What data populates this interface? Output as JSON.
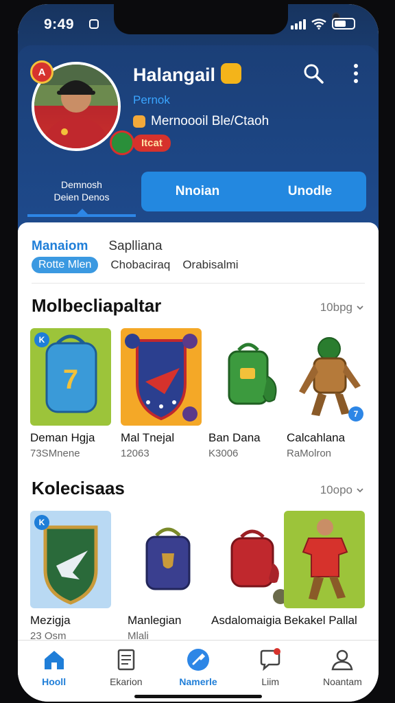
{
  "status_bar": {
    "time": "9:49"
  },
  "profile": {
    "name": "Halangail",
    "sublink": "Pernok",
    "user_line": "Mernoooil Ble/Ctaoh",
    "red_pill": "Itcat"
  },
  "tabs_top": {
    "left_label_line1": "Demnosh",
    "left_label_line2": "Deien Denos",
    "segment": [
      "Nnoian",
      "Unodle"
    ]
  },
  "filters": {
    "row1": [
      "Manaiom",
      "Saplliana"
    ],
    "row2_chip": "Rotte Mlen",
    "row2_items": [
      "Chobaciraq",
      "Orabisalmi"
    ]
  },
  "sections": [
    {
      "title": "Molbecliapaltar",
      "more": "10bpg",
      "items": [
        {
          "title": "Deman Hgja",
          "sub": "73SMnene",
          "bg": "#9cc43a",
          "corner": "K"
        },
        {
          "title": "Mal Tnejal",
          "sub": "12063",
          "bg": "#f4a827",
          "corner": ""
        },
        {
          "title": "Ban Dana",
          "sub": "K3006",
          "bg": "#ffffff",
          "corner": ""
        },
        {
          "title": "Calcahlana",
          "sub": "RaMolron",
          "bg": "#ffffff",
          "corner": "7"
        }
      ]
    },
    {
      "title": "Kolecisaas",
      "more": "10opo",
      "items": [
        {
          "title": "Mezigja",
          "sub": "23 Osm",
          "bg": "#b9d9f3",
          "corner": "K"
        },
        {
          "title": "Manlegian",
          "sub": "Mlali",
          "bg": "#ffffff",
          "corner": ""
        },
        {
          "title": "Asdalomaigia",
          "sub": "",
          "bg": "#ffffff",
          "corner": ""
        },
        {
          "title": "Bekakel Pallal",
          "sub": "",
          "bg": "#9cc43a",
          "corner": ""
        }
      ]
    }
  ],
  "tabbar": [
    {
      "label": "Hooll",
      "icon": "home-icon",
      "active": true
    },
    {
      "label": "Ekarion",
      "icon": "document-icon",
      "active": false
    },
    {
      "label": "Namerle",
      "icon": "tool-icon",
      "active": true
    },
    {
      "label": "Liim",
      "icon": "chat-icon",
      "active": false
    },
    {
      "label": "Noantam",
      "icon": "person-icon",
      "active": false
    }
  ],
  "colors": {
    "accent": "#1f7ed8",
    "header_bg": "#1c4a8a",
    "segment_bg": "#2388e0",
    "badge_red": "#d6322c"
  }
}
